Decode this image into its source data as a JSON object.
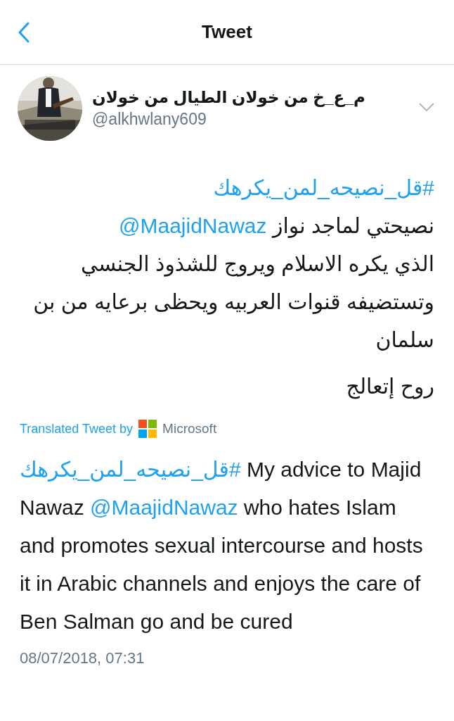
{
  "header": {
    "title": "Tweet"
  },
  "author": {
    "name": "م_ع_خ من خولان الطيال من خولان",
    "handle": "@alkhwlany609"
  },
  "tweet": {
    "paragraphs": [
      {
        "lines": [
          [
            {
              "kind": "hashtag",
              "text": "#قل_نصيحه_لمن_يكرهك"
            }
          ],
          [
            {
              "kind": "text",
              "text": "نصيحتي لماجد نواز "
            },
            {
              "kind": "mention",
              "text": "@MaajidNawaz"
            }
          ],
          [
            {
              "kind": "text",
              "text": " الذي يكره الاسلام ويروج للشذوذ الجنسي وتستضيفه قنوات العربيه ويحظى برعايه من بن سلمان"
            }
          ]
        ]
      },
      {
        "lines": [
          [
            {
              "kind": "text",
              "text": "روح إتعالج"
            }
          ]
        ]
      }
    ]
  },
  "translation": {
    "label": "Translated Tweet by",
    "provider": "Microsoft",
    "lines": [
      [
        {
          "kind": "hashtag",
          "text": "#قل_نصيحه_لمن_يكرهك"
        },
        {
          "kind": "text",
          "text": " My advice to Majid Nawaz "
        },
        {
          "kind": "mention",
          "text": "@MaajidNawaz"
        },
        {
          "kind": "text",
          "text": " who hates Islam and promotes sexual intercourse and hosts it in Arabic channels and enjoys the care of Ben Salman go and be cured"
        }
      ]
    ]
  },
  "timestamp": "08/07/2018, 07:31"
}
